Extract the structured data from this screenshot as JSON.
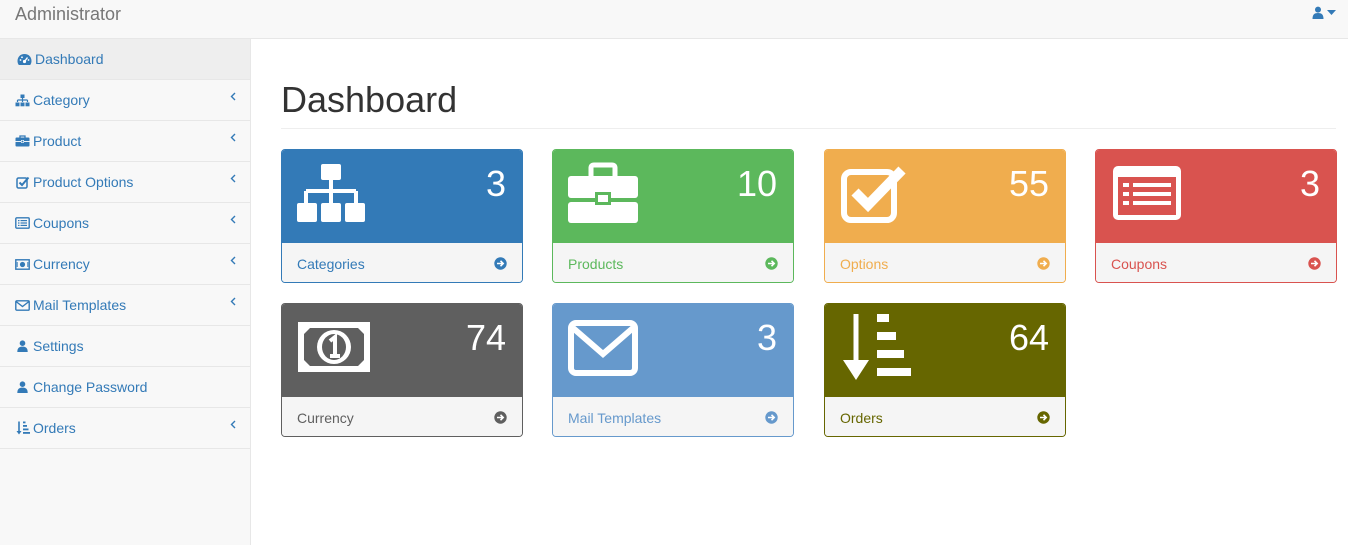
{
  "app": {
    "brand": "Administrator"
  },
  "sidebar": {
    "items": [
      {
        "label": "Dashboard",
        "icon": "dashboard-icon",
        "active": true,
        "has_submenu": false
      },
      {
        "label": "Category",
        "icon": "sitemap-icon",
        "has_submenu": true
      },
      {
        "label": "Product",
        "icon": "briefcase-icon",
        "has_submenu": true
      },
      {
        "label": "Product Options",
        "icon": "check-square-icon",
        "has_submenu": true
      },
      {
        "label": "Coupons",
        "icon": "list-alt-icon",
        "has_submenu": true
      },
      {
        "label": "Currency",
        "icon": "money-icon",
        "has_submenu": true
      },
      {
        "label": "Mail Templates",
        "icon": "envelope-icon",
        "has_submenu": true
      },
      {
        "label": "Settings",
        "icon": "user-icon",
        "has_submenu": false
      },
      {
        "label": "Change Password",
        "icon": "user-icon",
        "has_submenu": false
      },
      {
        "label": "Orders",
        "icon": "sort-amount-icon",
        "has_submenu": true
      }
    ]
  },
  "main": {
    "title": "Dashboard",
    "panels": [
      {
        "label": "Categories",
        "count": "3",
        "color": "#337ab7",
        "icon": "sitemap-icon"
      },
      {
        "label": "Products",
        "count": "10",
        "color": "#5cb85c",
        "icon": "briefcase-icon"
      },
      {
        "label": "Options",
        "count": "55",
        "color": "#f0ad4e",
        "icon": "check-square-icon"
      },
      {
        "label": "Coupons",
        "count": "3",
        "color": "#d9534f",
        "icon": "list-alt-icon"
      },
      {
        "label": "Currency",
        "count": "74",
        "color": "#5f5f5f",
        "icon": "money-icon"
      },
      {
        "label": "Mail Templates",
        "count": "3",
        "color": "#6699cc",
        "icon": "envelope-icon"
      },
      {
        "label": "Orders",
        "count": "64",
        "color": "#666600",
        "icon": "sort-amount-icon"
      }
    ]
  }
}
